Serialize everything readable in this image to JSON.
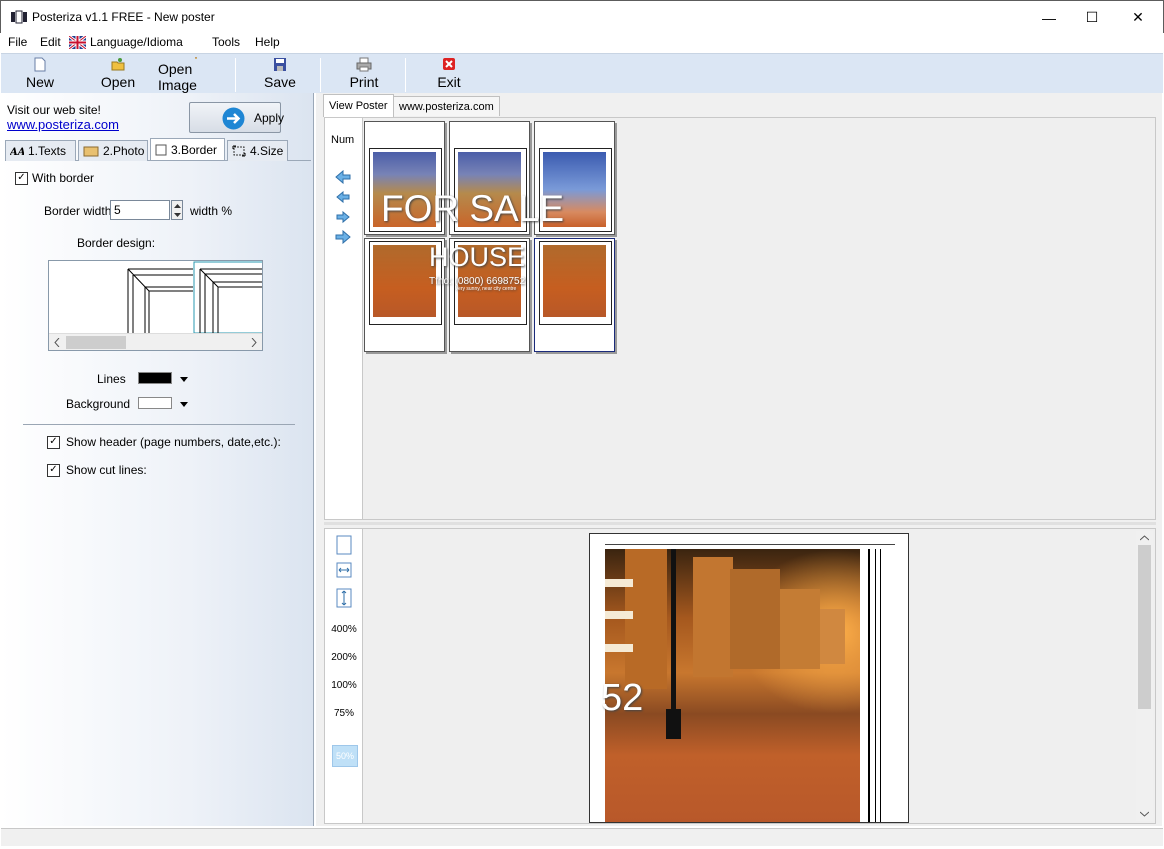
{
  "window": {
    "title": "Posteriza v1.1 FREE - New poster",
    "minimize": "—",
    "maximize": "☐",
    "close": "✕"
  },
  "menu": [
    "File",
    "Edit",
    "Language/Idioma",
    "Tools",
    "Help"
  ],
  "toolbar": {
    "new": "New",
    "open": "Open",
    "open_image": "Open Image",
    "save": "Save",
    "print": "Print",
    "exit": "Exit"
  },
  "left": {
    "visit_text": "Visit our web site!",
    "website": "www.posteriza.com",
    "apply": "Apply",
    "tabs": [
      "1.Texts",
      "2.Photo",
      "3.Border",
      "4.Size"
    ],
    "active_tab": "3.Border",
    "with_border": "With border",
    "with_border_checked": true,
    "border_width_label": "Border width",
    "border_width_value": "5",
    "width_unit": "width %",
    "border_design_label": "Border design:",
    "lines_label": "Lines",
    "lines_color": "#000000",
    "background_label": "Background",
    "background_color": "#ffffff",
    "show_header": "Show header (page numbers, date,etc.):",
    "show_header_checked": true,
    "show_cut_lines": "Show cut lines:",
    "show_cut_lines_checked": true
  },
  "right": {
    "tabs": [
      "View Poster",
      "www.posteriza.com"
    ],
    "active_tab": "View Poster",
    "num_label": "Num",
    "poster_title": "FOR SALE",
    "poster_subtitle": "HOUSE",
    "poster_phone": "Tfno: (0800) 6698752",
    "poster_small": "Very sunny, near city centre",
    "zoom_levels": [
      "400%",
      "200%",
      "100%",
      "75%",
      "50%"
    ],
    "zoom_active": "50%",
    "preview_number": "52"
  }
}
